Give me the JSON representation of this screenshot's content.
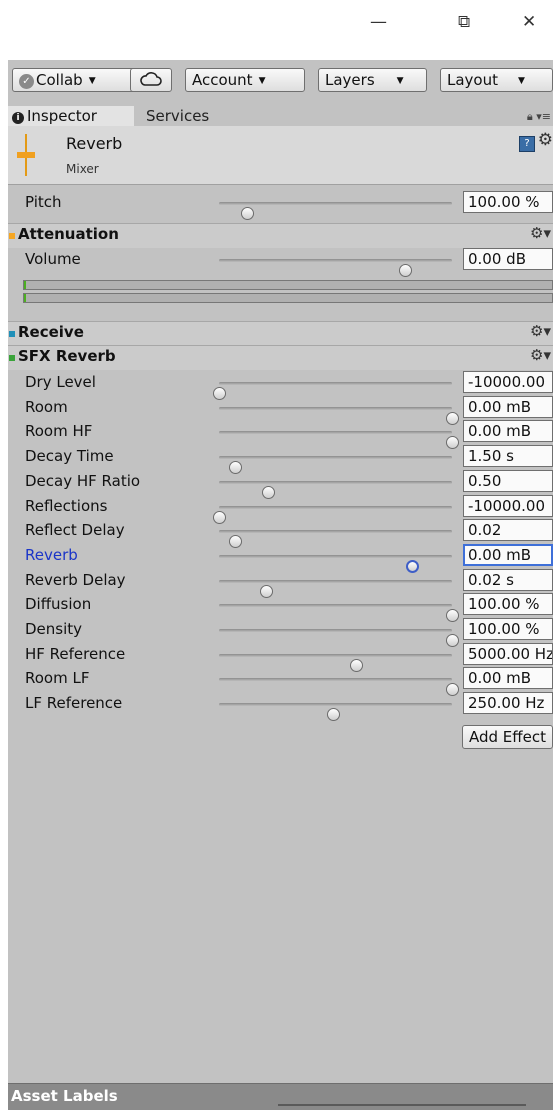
{
  "window_controls": {
    "minimize": "—",
    "restore": "⧉",
    "close": "✕"
  },
  "toolbar": {
    "collab": "Collab",
    "cloud_icon": "cloud-icon",
    "account": "Account",
    "layers": "Layers",
    "layout": "Layout"
  },
  "tabs": [
    {
      "label": "Inspector",
      "active": true
    },
    {
      "label": "Services",
      "active": false
    }
  ],
  "header": {
    "title": "Reverb",
    "subtitle": "Mixer"
  },
  "pitch": {
    "label": "Pitch",
    "value": "100.00 %",
    "slider": 0.12
  },
  "attenuation": {
    "title": "Attenuation",
    "color": "#f5a623",
    "volume": {
      "label": "Volume",
      "value": "0.00 dB",
      "slider": 0.8
    }
  },
  "receive": {
    "title": "Receive",
    "color": "#1f8fb8"
  },
  "sfx_reverb": {
    "title": "SFX Reverb",
    "color": "#3aa33a",
    "params": [
      {
        "label": "Dry Level",
        "value": "-10000.00",
        "slider": 0.0
      },
      {
        "label": "Room",
        "value": "0.00 mB",
        "slider": 1.0
      },
      {
        "label": "Room HF",
        "value": "0.00 mB",
        "slider": 1.0
      },
      {
        "label": "Decay Time",
        "value": "1.50 s",
        "slider": 0.07
      },
      {
        "label": "Decay HF Ratio",
        "value": "0.50",
        "slider": 0.21
      },
      {
        "label": "Reflections",
        "value": "-10000.00",
        "slider": 0.0
      },
      {
        "label": "Reflect Delay",
        "value": "0.02",
        "slider": 0.07
      },
      {
        "label": "Reverb",
        "value": "0.00 mB",
        "slider": 0.83,
        "active": true
      },
      {
        "label": "Reverb Delay",
        "value": "0.02 s",
        "slider": 0.2
      },
      {
        "label": "Diffusion",
        "value": "100.00 %",
        "slider": 1.0
      },
      {
        "label": "Density",
        "value": "100.00 %",
        "slider": 1.0
      },
      {
        "label": "HF Reference",
        "value": "5000.00 Hz",
        "slider": 0.59
      },
      {
        "label": "Room LF",
        "value": "0.00 mB",
        "slider": 1.0
      },
      {
        "label": "LF Reference",
        "value": "250.00 Hz",
        "slider": 0.49
      }
    ]
  },
  "add_effect": "Add Effect",
  "asset_labels": "Asset Labels"
}
